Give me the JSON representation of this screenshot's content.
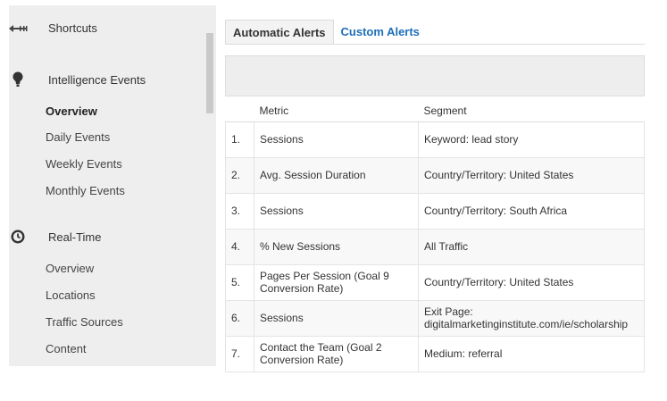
{
  "sidebar": {
    "shortcuts": {
      "label": "Shortcuts",
      "icon": "shortcuts-arrow-icon"
    },
    "intelligence": {
      "label": "Intelligence Events",
      "icon": "lightbulb-icon",
      "items": [
        "Overview",
        "Daily Events",
        "Weekly Events",
        "Monthly Events"
      ],
      "active": "Overview"
    },
    "realtime": {
      "label": "Real-Time",
      "icon": "clock-icon",
      "items": [
        "Overview",
        "Locations",
        "Traffic Sources",
        "Content"
      ]
    }
  },
  "tabs": [
    "Automatic Alerts",
    "Custom Alerts"
  ],
  "active_tab": "Automatic Alerts",
  "table": {
    "headers": [
      "",
      "Metric",
      "Segment"
    ],
    "rows": [
      {
        "num": "1.",
        "metric": "Sessions",
        "segment": "Keyword: lead story"
      },
      {
        "num": "2.",
        "metric": "Avg. Session Duration",
        "segment": "Country/Territory: United States"
      },
      {
        "num": "3.",
        "metric": "Sessions",
        "segment": "Country/Territory: South Africa"
      },
      {
        "num": "4.",
        "metric": "% New Sessions",
        "segment": "All Traffic"
      },
      {
        "num": "5.",
        "metric": "Pages Per Session (Goal 9 Conversion Rate)",
        "segment": "Country/Territory: United States"
      },
      {
        "num": "6.",
        "metric": "Sessions",
        "segment": "Exit Page: digitalmarketinginstitute.com/ie/scholarship"
      },
      {
        "num": "7.",
        "metric": "Contact the Team (Goal 2 Conversion Rate)",
        "segment": "Medium: referral"
      }
    ]
  },
  "colors": {
    "accent": "#1e6fb8",
    "sidebar_bg": "#eeeeee"
  }
}
